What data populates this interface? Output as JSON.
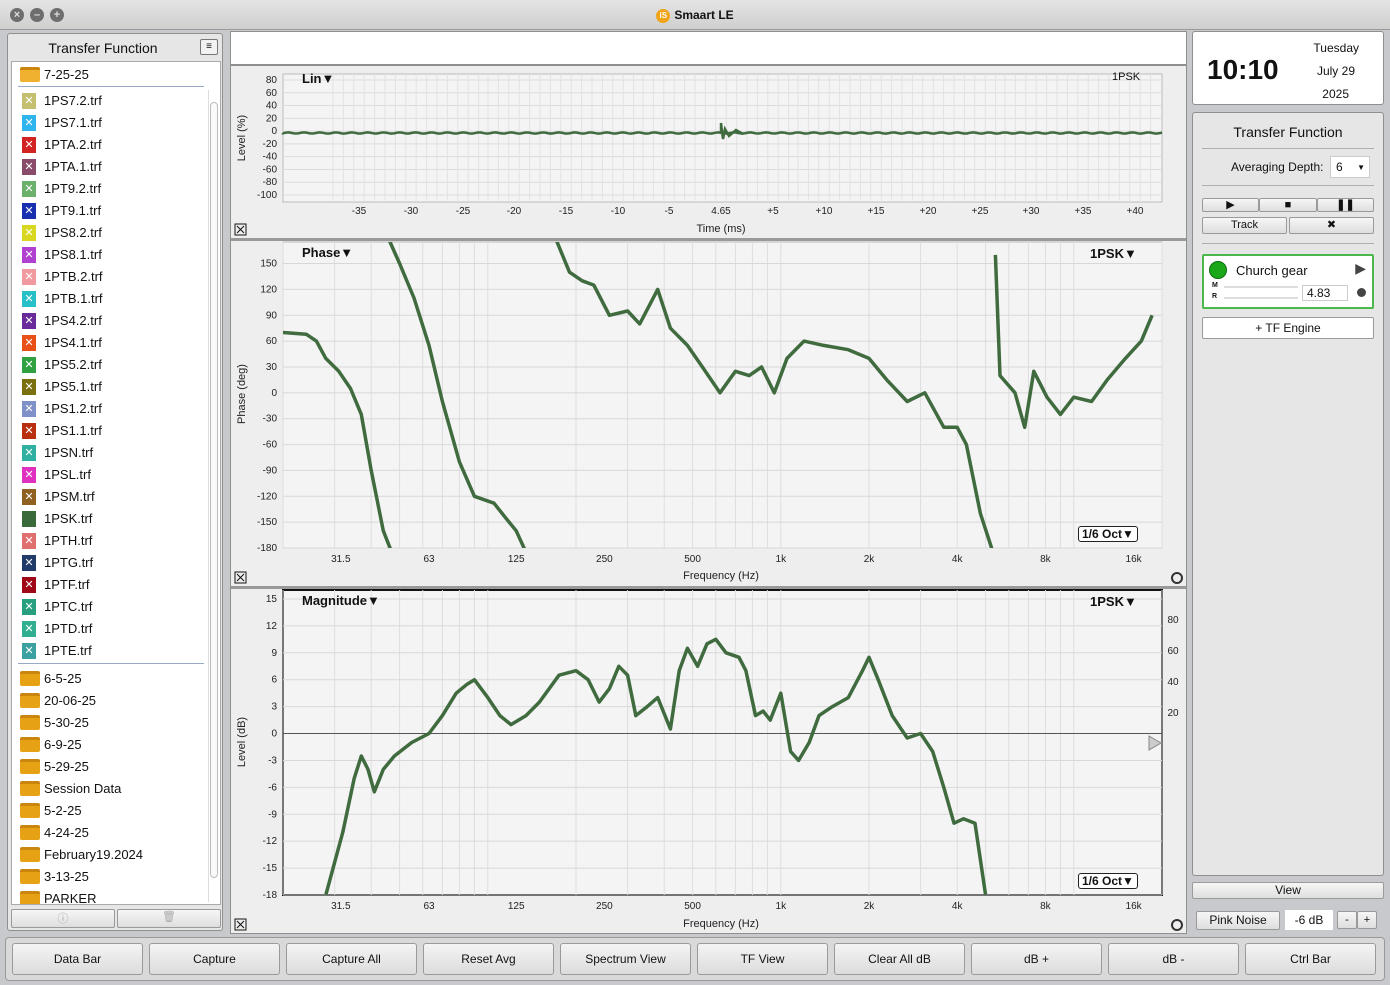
{
  "app": {
    "title": "Smaart LE",
    "logo_text": "iS"
  },
  "sidebar": {
    "title": "Transfer Function",
    "current_folder": "7-25-25",
    "files": [
      {
        "name": "1PS7.2.trf",
        "color": "#c5c070"
      },
      {
        "name": "1PS7.1.trf",
        "color": "#2fb4ee"
      },
      {
        "name": "1PTA.2.trf",
        "color": "#d22222"
      },
      {
        "name": "1PTA.1.trf",
        "color": "#8a4a6a"
      },
      {
        "name": "1PT9.2.trf",
        "color": "#6bb06b"
      },
      {
        "name": "1PT9.1.trf",
        "color": "#1830b0"
      },
      {
        "name": "1PS8.2.trf",
        "color": "#d8d820"
      },
      {
        "name": "1PS8.1.trf",
        "color": "#b040d0"
      },
      {
        "name": "1PTB.2.trf",
        "color": "#f09aa0"
      },
      {
        "name": "1PTB.1.trf",
        "color": "#28c0c8"
      },
      {
        "name": "1PS4.2.trf",
        "color": "#6a2a9a"
      },
      {
        "name": "1PS4.1.trf",
        "color": "#e85018"
      },
      {
        "name": "1PS5.2.trf",
        "color": "#30a040"
      },
      {
        "name": "1PS5.1.trf",
        "color": "#7a7010"
      },
      {
        "name": "1PS1.2.trf",
        "color": "#8090c8"
      },
      {
        "name": "1PS1.1.trf",
        "color": "#b83010"
      },
      {
        "name": "1PSN.trf",
        "color": "#30b0a0"
      },
      {
        "name": "1PSL.trf",
        "color": "#e030c0"
      },
      {
        "name": "1PSM.trf",
        "color": "#906020"
      },
      {
        "name": "1PSK.trf",
        "color": "#3a6a3a"
      },
      {
        "name": "1PTH.trf",
        "color": "#e07070"
      },
      {
        "name": "1PTG.trf",
        "color": "#203a6a"
      },
      {
        "name": "1PTF.trf",
        "color": "#a00818"
      },
      {
        "name": "1PTC.trf",
        "color": "#28a080"
      },
      {
        "name": "1PTD.trf",
        "color": "#30b090"
      },
      {
        "name": "1PTE.trf",
        "color": "#3aa0a0"
      }
    ],
    "folders": [
      "6-5-25",
      "20-06-25",
      "5-30-25",
      "6-9-25",
      "5-29-25",
      "Session Data",
      "5-2-25",
      "4-24-25",
      "February19.2024",
      "3-13-25",
      "PARKER"
    ]
  },
  "clock": {
    "time": "10:10",
    "day": "Tuesday",
    "date": "July 29",
    "year": "2025"
  },
  "tf_panel": {
    "title": "Transfer Function",
    "avg_label": "Averaging Depth:",
    "avg_value": "6",
    "track_label": "Track",
    "engine": {
      "name": "Church gear",
      "m_label": "M",
      "r_label": "R",
      "delay": "4.83"
    },
    "add_engine": "+ TF Engine",
    "view_label": "View",
    "pink_noise": "Pink Noise",
    "level": "-6 dB",
    "minus": "-",
    "plus": "+"
  },
  "ir_plot": {
    "mode": "Lin▼",
    "trace": "1PSK",
    "ylabel": "Level (%)",
    "xlabel": "Time (ms)",
    "yticks": [
      "80",
      "60",
      "40",
      "20",
      "0",
      "-20",
      "-40",
      "-60",
      "-80",
      "-100"
    ],
    "xticks": [
      "-35",
      "-30",
      "-25",
      "-20",
      "-15",
      "-10",
      "-5",
      "4.65",
      "+5",
      "+10",
      "+15",
      "+20",
      "+25",
      "+30",
      "+35",
      "+40"
    ]
  },
  "phase_plot": {
    "mode": "Phase▼",
    "trace": "1PSK▼",
    "ylabel": "Phase (deg)",
    "xlabel": "Frequency (Hz)",
    "smoothing": "1/6 Oct▼",
    "yticks": [
      "150",
      "120",
      "90",
      "60",
      "30",
      "0",
      "-30",
      "-60",
      "-90",
      "-120",
      "-150",
      "-180"
    ],
    "xticks": [
      "31.5",
      "63",
      "125",
      "250",
      "500",
      "1k",
      "2k",
      "4k",
      "8k",
      "16k"
    ]
  },
  "mag_plot": {
    "mode": "Magnitude▼",
    "trace": "1PSK▼",
    "ylabel": "Level (dB)",
    "xlabel": "Frequency (Hz)",
    "smoothing": "1/6 Oct▼",
    "yticks": [
      "15",
      "12",
      "9",
      "6",
      "3",
      "0",
      "-3",
      "-6",
      "-9",
      "-12",
      "-15",
      "-18"
    ],
    "coh_ticks": [
      "80",
      "60",
      "40",
      "20"
    ],
    "xticks": [
      "31.5",
      "63",
      "125",
      "250",
      "500",
      "1k",
      "2k",
      "4k",
      "8k",
      "16k"
    ]
  },
  "chart_data": [
    {
      "type": "line",
      "title": "Phase",
      "xlabel": "Frequency (Hz)",
      "ylabel": "Phase (deg)",
      "x_scale": "log",
      "ylim": [
        -180,
        180
      ],
      "series": [
        {
          "name": "1PSK",
          "points": [
            [
              20,
              70
            ],
            [
              24,
              68
            ],
            [
              26,
              60
            ],
            [
              28,
              40
            ],
            [
              31,
              25
            ],
            [
              34,
              5
            ],
            [
              37,
              -25
            ],
            [
              40,
              -90
            ],
            [
              44,
              -160
            ],
            [
              47,
              -190
            ],
            [
              45,
              185
            ],
            [
              50,
              150
            ],
            [
              56,
              110
            ],
            [
              63,
              55
            ],
            [
              70,
              -10
            ],
            [
              80,
              -80
            ],
            [
              90,
              -120
            ],
            [
              105,
              -128
            ],
            [
              115,
              -145
            ],
            [
              125,
              -160
            ],
            [
              135,
              -185
            ],
            [
              170,
              180
            ],
            [
              190,
              140
            ],
            [
              210,
              130
            ],
            [
              230,
              125
            ],
            [
              260,
              90
            ],
            [
              300,
              95
            ],
            [
              330,
              80
            ],
            [
              380,
              120
            ],
            [
              420,
              75
            ],
            [
              480,
              55
            ],
            [
              540,
              30
            ],
            [
              620,
              0
            ],
            [
              700,
              25
            ],
            [
              780,
              20
            ],
            [
              860,
              30
            ],
            [
              950,
              0
            ],
            [
              1050,
              40
            ],
            [
              1200,
              60
            ],
            [
              1400,
              55
            ],
            [
              1700,
              50
            ],
            [
              2000,
              40
            ],
            [
              2300,
              15
            ],
            [
              2700,
              -10
            ],
            [
              3100,
              0
            ],
            [
              3600,
              -40
            ],
            [
              4000,
              -40
            ],
            [
              4300,
              -60
            ],
            [
              4800,
              -140
            ],
            [
              5300,
              -185
            ],
            [
              5400,
              160
            ],
            [
              5600,
              20
            ],
            [
              6300,
              0
            ],
            [
              6800,
              -40
            ],
            [
              7300,
              25
            ],
            [
              8100,
              -5
            ],
            [
              9000,
              -25
            ],
            [
              10000,
              -5
            ],
            [
              11500,
              -10
            ],
            [
              13000,
              15
            ],
            [
              15000,
              40
            ],
            [
              17000,
              60
            ],
            [
              18500,
              90
            ]
          ]
        }
      ]
    },
    {
      "type": "line",
      "title": "Magnitude",
      "xlabel": "Frequency (Hz)",
      "ylabel": "Level (dB)",
      "x_scale": "log",
      "ylim": [
        -18,
        16
      ],
      "series": [
        {
          "name": "1PSK",
          "points": [
            [
              28,
              -18
            ],
            [
              32,
              -11
            ],
            [
              35,
              -5
            ],
            [
              37,
              -2.5
            ],
            [
              39,
              -4
            ],
            [
              41,
              -6.5
            ],
            [
              44,
              -4
            ],
            [
              48,
              -2.5
            ],
            [
              55,
              -1
            ],
            [
              63,
              0
            ],
            [
              70,
              2
            ],
            [
              78,
              4.5
            ],
            [
              85,
              5.5
            ],
            [
              90,
              6
            ],
            [
              100,
              4
            ],
            [
              110,
              2
            ],
            [
              120,
              1
            ],
            [
              135,
              2
            ],
            [
              150,
              3.5
            ],
            [
              175,
              6.5
            ],
            [
              200,
              7
            ],
            [
              220,
              6
            ],
            [
              240,
              3.5
            ],
            [
              260,
              5
            ],
            [
              280,
              7.5
            ],
            [
              300,
              6.5
            ],
            [
              320,
              2
            ],
            [
              350,
              3
            ],
            [
              380,
              4
            ],
            [
              420,
              0.5
            ],
            [
              450,
              7
            ],
            [
              480,
              9.5
            ],
            [
              520,
              7.5
            ],
            [
              560,
              10
            ],
            [
              600,
              10.5
            ],
            [
              650,
              9
            ],
            [
              720,
              8.5
            ],
            [
              760,
              7
            ],
            [
              820,
              2
            ],
            [
              870,
              2.5
            ],
            [
              920,
              1.5
            ],
            [
              1000,
              4.5
            ],
            [
              1080,
              -2
            ],
            [
              1150,
              -3
            ],
            [
              1250,
              -1
            ],
            [
              1350,
              2
            ],
            [
              1500,
              3
            ],
            [
              1700,
              4
            ],
            [
              1900,
              7
            ],
            [
              2000,
              8.5
            ],
            [
              2150,
              6
            ],
            [
              2400,
              2
            ],
            [
              2700,
              -0.5
            ],
            [
              3000,
              0
            ],
            [
              3300,
              -2
            ],
            [
              3600,
              -6
            ],
            [
              3900,
              -10
            ],
            [
              4200,
              -9.5
            ],
            [
              4600,
              -10
            ],
            [
              5000,
              -18
            ]
          ]
        }
      ]
    }
  ],
  "bottom_buttons": [
    "Data Bar",
    "Capture",
    "Capture All",
    "Reset Avg",
    "Spectrum View",
    "TF View",
    "Clear All dB",
    "dB +",
    "dB -",
    "Ctrl Bar"
  ]
}
